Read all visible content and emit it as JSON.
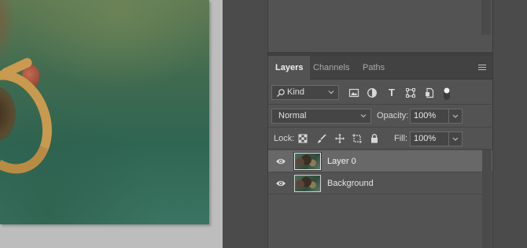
{
  "tabs": [
    {
      "label": "Layers",
      "active": true
    },
    {
      "label": "Channels",
      "active": false
    },
    {
      "label": "Paths",
      "active": false
    }
  ],
  "filter": {
    "kind_label": "Kind",
    "icons": [
      "image-filter-icon",
      "adjustment-filter-icon",
      "type-filter-icon",
      "shape-filter-icon",
      "smart-object-filter-icon",
      "filter-toggle"
    ]
  },
  "blend": {
    "mode": "Normal",
    "opacity_label": "Opacity:",
    "opacity_value": "100%"
  },
  "lock": {
    "label": "Lock:",
    "fill_label": "Fill:",
    "fill_value": "100%"
  },
  "layers": [
    {
      "name": "Layer 0",
      "selected": true,
      "visible": true
    },
    {
      "name": "Background",
      "selected": false,
      "visible": true
    }
  ],
  "colors": {
    "panel_bg": "#535353",
    "tab_bar_bg": "#424242",
    "selected_row_bg": "#686868",
    "text": "#e4e4e4"
  }
}
